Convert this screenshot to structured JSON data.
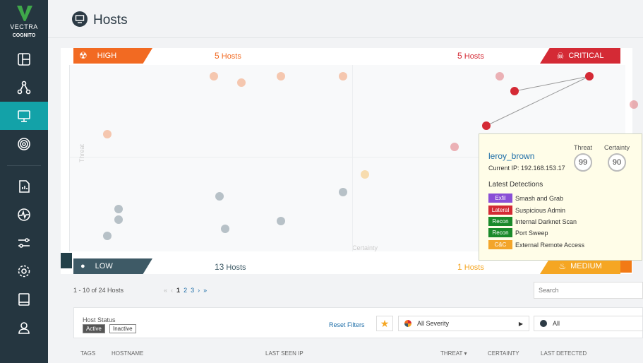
{
  "brand": {
    "name": "VECTRA",
    "product": "COGNITO"
  },
  "page": {
    "title": "Hosts"
  },
  "quadrants": {
    "high": {
      "label": "HIGH",
      "count": "5",
      "unit": "Hosts"
    },
    "critical": {
      "label": "CRITICAL",
      "count": "5",
      "unit": "Hosts"
    },
    "low": {
      "label": "LOW",
      "count": "13",
      "unit": "Hosts"
    },
    "medium": {
      "label": "MEDIUM",
      "count": "1",
      "unit": "Hosts"
    },
    "axis": {
      "y": "Threat",
      "x": "Certainty"
    }
  },
  "tooltip": {
    "hostname": "leroy_brown",
    "ip": "Current IP: 192.168.153.17",
    "threat_label": "Threat",
    "certainty_label": "Certainty",
    "threat": "99",
    "certainty": "90",
    "latest_title": "Latest Detections",
    "detections": [
      {
        "tag": "Exfil",
        "name": "Smash and Grab",
        "color": "#8a4fd6"
      },
      {
        "tag": "Lateral",
        "name": "Suspicious Admin",
        "color": "#d32a34"
      },
      {
        "tag": "Recon",
        "name": "Internal Darknet Scan",
        "color": "#1a8a2a"
      },
      {
        "tag": "Recon",
        "name": "Port Sweep",
        "color": "#1a8a2a"
      },
      {
        "tag": "C&C",
        "name": "External Remote Access",
        "color": "#f3a52a"
      }
    ]
  },
  "list": {
    "range": "1 - 10 of 24 Hosts",
    "pages": {
      "first": "«",
      "prev": "‹",
      "p1": "1",
      "p2": "2",
      "p3": "3",
      "next": "›",
      "last": "»"
    },
    "search_placeholder": "Search"
  },
  "filters": {
    "host_status_label": "Host Status",
    "active": "Active",
    "inactive": "Inactive",
    "reset": "Reset Filters",
    "severity": "All Severity",
    "scope": "All"
  },
  "columns": [
    "TAGS",
    "HOSTNAME",
    "LAST SEEN IP",
    "THREAT ▾",
    "CERTAINTY",
    "LAST DETECTED"
  ],
  "colors": {
    "high": "#f26a22",
    "critical": "#d42a35",
    "low": "#3e5a66",
    "medium": "#f5a623",
    "sidebar": "#253640",
    "accent": "#13a2a8"
  }
}
